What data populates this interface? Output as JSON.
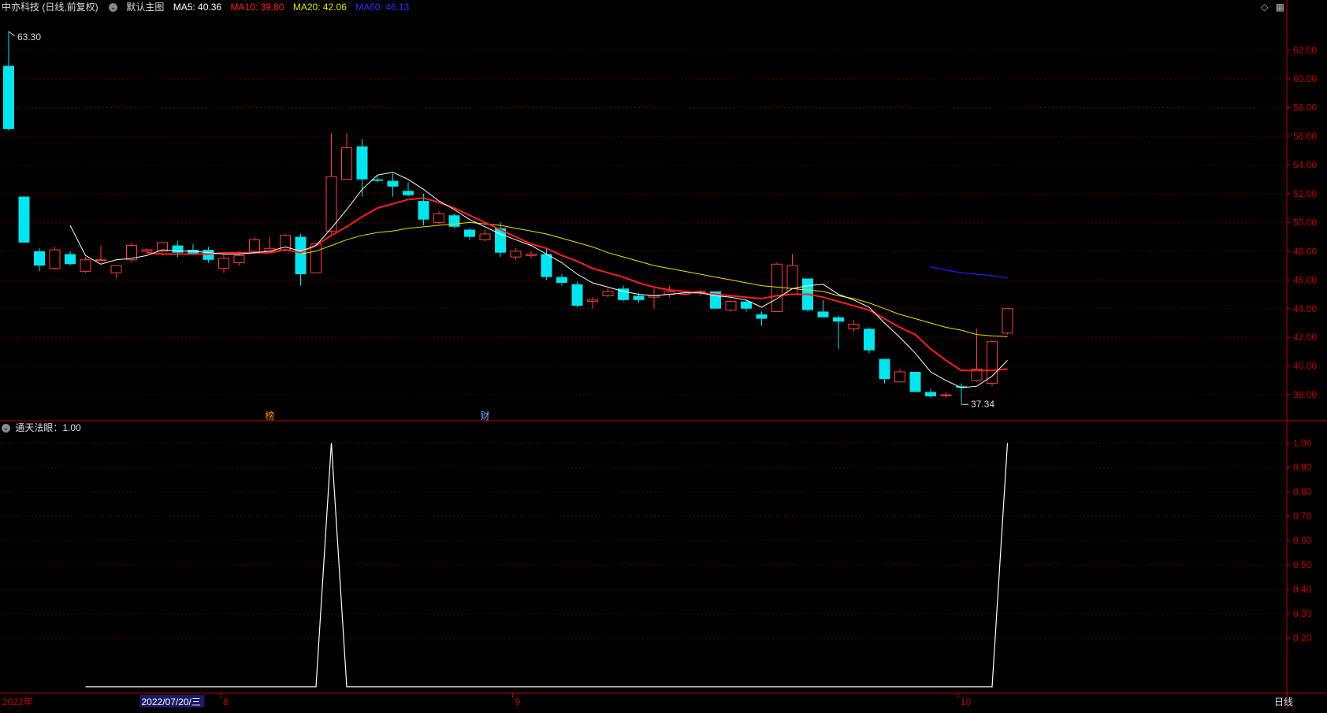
{
  "header": {
    "stock": "中亦科技 (日线,前复权)",
    "main_chart": "默认主图",
    "ma5": "MA5: 40.36",
    "ma10": "MA10: 39.80",
    "ma20": "MA20: 42.06",
    "ma60": "MA60: 46.13"
  },
  "indicator_header": {
    "label": "通天法眼",
    "value": "：1.00"
  },
  "period_label": "日线",
  "icons": [
    "diamond-icon",
    "menu-icon",
    "chevron-down-icon"
  ],
  "colors": {
    "up": "#ff4040",
    "down": "#00e5ee",
    "ma5": "#ffffff",
    "ma10": "#ff2020",
    "ma20": "#e8e000",
    "ma60": "#2020ff",
    "axis": "#c00000",
    "grid": "#5a0000"
  },
  "chart_data": [
    {
      "type": "candlestick",
      "y_axis_ticks": [
        62,
        60,
        58,
        56,
        54,
        52,
        50,
        48,
        46,
        44,
        42,
        40,
        38
      ],
      "y_tick_labels": [
        "62.00",
        "60.00",
        "58.00",
        "56.00",
        "54.00",
        "52.00",
        "50.00",
        "48.00",
        "46.00",
        "44.00",
        "42.00",
        "40.00",
        "38.00"
      ],
      "ylim": [
        36.2,
        64.5
      ],
      "annotations": {
        "high": "63.30",
        "low": "37.34",
        "markers": [
          "榜",
          "财"
        ]
      },
      "candles": [
        [
          60.9,
          63.3,
          56.4,
          56.5
        ],
        [
          51.8,
          51.8,
          48.6,
          48.6
        ],
        [
          48.0,
          48.2,
          46.6,
          47.0
        ],
        [
          46.8,
          48.3,
          46.7,
          48.1
        ],
        [
          47.8,
          48.0,
          47.0,
          47.1
        ],
        [
          46.6,
          47.6,
          46.5,
          47.4
        ],
        [
          47.4,
          48.4,
          47.3,
          47.4
        ],
        [
          46.5,
          47.0,
          46.1,
          47.0
        ],
        [
          47.4,
          48.6,
          47.2,
          48.4
        ],
        [
          48.0,
          48.2,
          47.8,
          48.1
        ],
        [
          48.0,
          48.4,
          47.7,
          48.6
        ],
        [
          48.4,
          48.7,
          47.6,
          47.9
        ],
        [
          48.1,
          48.5,
          47.8,
          47.8
        ],
        [
          48.1,
          48.3,
          47.2,
          47.4
        ],
        [
          46.8,
          47.8,
          46.5,
          47.5
        ],
        [
          47.2,
          48.0,
          47.0,
          47.7
        ],
        [
          48.0,
          49.0,
          47.8,
          48.8
        ],
        [
          48.0,
          49.0,
          47.9,
          48.2
        ],
        [
          48.1,
          49.2,
          48.0,
          49.1
        ],
        [
          49.0,
          49.2,
          45.6,
          46.4
        ],
        [
          46.5,
          48.6,
          46.5,
          48.5
        ],
        [
          49.4,
          56.2,
          49.2,
          53.2
        ],
        [
          53.0,
          56.2,
          53.0,
          55.2
        ],
        [
          55.3,
          55.8,
          51.8,
          53.0
        ],
        [
          53.0,
          53.2,
          52.8,
          52.9
        ],
        [
          52.9,
          53.4,
          51.8,
          52.5
        ],
        [
          52.2,
          52.8,
          51.8,
          51.9
        ],
        [
          51.5,
          52.0,
          49.8,
          50.2
        ],
        [
          50.0,
          50.8,
          49.9,
          50.6
        ],
        [
          50.5,
          50.6,
          49.6,
          49.7
        ],
        [
          49.5,
          49.6,
          48.8,
          49.0
        ],
        [
          48.8,
          49.5,
          48.7,
          49.2
        ],
        [
          49.6,
          50.0,
          47.6,
          47.9
        ],
        [
          47.6,
          48.2,
          47.4,
          48.0
        ],
        [
          47.7,
          48.0,
          47.5,
          47.8
        ],
        [
          47.8,
          48.2,
          46.0,
          46.2
        ],
        [
          46.2,
          46.4,
          45.6,
          45.8
        ],
        [
          45.7,
          45.9,
          44.1,
          44.2
        ],
        [
          44.5,
          44.8,
          44.0,
          44.6
        ],
        [
          44.9,
          45.4,
          44.8,
          45.2
        ],
        [
          45.4,
          45.6,
          44.5,
          44.6
        ],
        [
          44.9,
          45.1,
          44.4,
          44.6
        ],
        [
          44.8,
          45.4,
          44.0,
          44.9
        ],
        [
          45.0,
          45.6,
          44.8,
          45.2
        ],
        [
          45.0,
          45.2,
          44.9,
          45.1
        ],
        [
          45.2,
          45.3,
          44.9,
          45.2
        ],
        [
          45.2,
          45.2,
          44.0,
          44.0
        ],
        [
          43.9,
          44.6,
          43.8,
          44.5
        ],
        [
          44.5,
          44.6,
          43.8,
          44.0
        ],
        [
          43.6,
          43.8,
          42.8,
          43.3
        ],
        [
          43.8,
          47.2,
          43.8,
          47.1
        ],
        [
          45.0,
          47.8,
          45.0,
          47.0
        ],
        [
          46.1,
          46.1,
          43.8,
          43.9
        ],
        [
          43.8,
          44.6,
          43.4,
          43.4
        ],
        [
          43.4,
          43.5,
          41.2,
          43.1
        ],
        [
          42.6,
          43.2,
          42.4,
          42.9
        ],
        [
          42.6,
          42.7,
          40.9,
          41.1
        ],
        [
          40.5,
          40.5,
          38.8,
          39.1
        ],
        [
          38.9,
          39.8,
          38.9,
          39.6
        ],
        [
          39.6,
          39.6,
          38.2,
          38.2
        ],
        [
          38.2,
          38.4,
          37.8,
          37.9
        ],
        [
          38.0,
          38.2,
          37.8,
          38.0
        ],
        [
          38.6,
          38.8,
          37.34,
          38.5
        ],
        [
          39.0,
          42.6,
          38.9,
          39.8
        ],
        [
          38.8,
          41.8,
          38.6,
          41.7
        ],
        [
          42.3,
          44.0,
          42.2,
          44.0
        ]
      ],
      "ma5_values": [
        null,
        null,
        null,
        null,
        49.8,
        47.7,
        47.1,
        47.4,
        47.5,
        47.7,
        48.1,
        48.0,
        48.0,
        47.9,
        47.8,
        47.8,
        47.9,
        48.0,
        48.3,
        48.0,
        48.4,
        49.6,
        50.9,
        52.3,
        53.3,
        53.5,
        53.0,
        52.3,
        51.5,
        50.9,
        50.2,
        49.7,
        49.2,
        48.8,
        48.4,
        47.8,
        47.2,
        46.4,
        45.8,
        45.5,
        45.2,
        45.0,
        44.9,
        45.0,
        45.1,
        45.1,
        44.9,
        44.8,
        44.6,
        44.1,
        44.7,
        45.4,
        45.6,
        45.7,
        45.0,
        44.6,
        44.1,
        43.0,
        42.0,
        40.9,
        39.6,
        39.0,
        38.5,
        38.6,
        39.3,
        40.4
      ],
      "ma10_values": [
        null,
        null,
        null,
        null,
        null,
        null,
        null,
        null,
        null,
        47.9,
        47.8,
        47.8,
        47.8,
        47.8,
        47.9,
        47.9,
        47.9,
        47.9,
        48.1,
        47.9,
        48.4,
        49.1,
        49.7,
        50.4,
        51.0,
        51.3,
        51.6,
        51.7,
        51.4,
        51.0,
        50.5,
        50.0,
        49.5,
        49.0,
        48.5,
        48.2,
        47.7,
        47.3,
        46.8,
        46.5,
        46.2,
        45.8,
        45.5,
        45.3,
        45.2,
        45.1,
        45.0,
        44.9,
        44.8,
        44.7,
        44.9,
        45.0,
        45.0,
        44.8,
        44.5,
        44.2,
        43.9,
        43.3,
        42.7,
        42.2,
        41.2,
        40.4,
        39.7,
        39.7,
        39.7,
        39.8
      ],
      "ma20_values": [
        null,
        null,
        null,
        null,
        null,
        null,
        null,
        null,
        null,
        null,
        null,
        null,
        null,
        null,
        null,
        null,
        null,
        null,
        null,
        47.8,
        48.0,
        48.4,
        48.8,
        49.1,
        49.3,
        49.4,
        49.6,
        49.7,
        49.8,
        49.9,
        50.0,
        49.9,
        49.8,
        49.6,
        49.4,
        49.2,
        48.9,
        48.6,
        48.3,
        47.9,
        47.6,
        47.3,
        47.0,
        46.8,
        46.6,
        46.4,
        46.2,
        46.0,
        45.8,
        45.6,
        45.5,
        45.4,
        45.3,
        45.2,
        44.9,
        44.7,
        44.4,
        44.0,
        43.6,
        43.3,
        43.0,
        42.7,
        42.5,
        42.2,
        42.1,
        42.06
      ],
      "ma60_values": [
        null,
        null,
        null,
        null,
        null,
        null,
        null,
        null,
        null,
        null,
        null,
        null,
        null,
        null,
        null,
        null,
        null,
        null,
        null,
        null,
        null,
        null,
        null,
        null,
        null,
        null,
        null,
        null,
        null,
        null,
        null,
        null,
        null,
        null,
        null,
        null,
        null,
        null,
        null,
        null,
        null,
        null,
        null,
        null,
        null,
        null,
        null,
        null,
        null,
        null,
        null,
        null,
        null,
        null,
        null,
        null,
        null,
        null,
        null,
        null,
        46.9,
        46.7,
        46.5,
        46.4,
        46.3,
        46.13
      ]
    },
    {
      "type": "line",
      "title": "通天法眼",
      "y_axis_ticks": [
        1.0,
        0.9,
        0.8,
        0.7,
        0.6,
        0.5,
        0.4,
        0.3,
        0.2
      ],
      "y_tick_labels": [
        "1.00",
        "0.90",
        "0.80",
        "0.70",
        "0.60",
        "0.50",
        "0.40",
        "0.30",
        "0.20"
      ],
      "ylim": [
        -0.02,
        1.03
      ],
      "x_start_index": 5,
      "values": [
        0,
        0,
        0,
        0,
        0,
        0,
        0,
        0,
        0,
        0,
        0,
        0,
        0,
        0,
        0,
        0,
        1,
        0,
        0,
        0,
        0,
        0,
        0,
        0,
        0,
        0,
        0,
        0,
        0,
        0,
        0,
        0,
        0,
        0,
        0,
        0,
        0,
        0,
        0,
        0,
        0,
        0,
        0,
        0,
        0,
        0,
        0,
        0,
        0,
        0,
        0,
        0,
        0,
        0,
        0,
        0,
        0,
        0,
        0,
        0,
        1
      ]
    }
  ],
  "x_axis_labels": {
    "year": "2022年",
    "cursor_date": "2022/07/20/三",
    "months": [
      "8",
      "9",
      "10"
    ]
  },
  "x_axis_label_indices": {
    "year": 0,
    "cursor_date": 7,
    "months": [
      14,
      33,
      62
    ]
  },
  "marker_indices": {
    "榜": 17,
    "财": 31
  }
}
